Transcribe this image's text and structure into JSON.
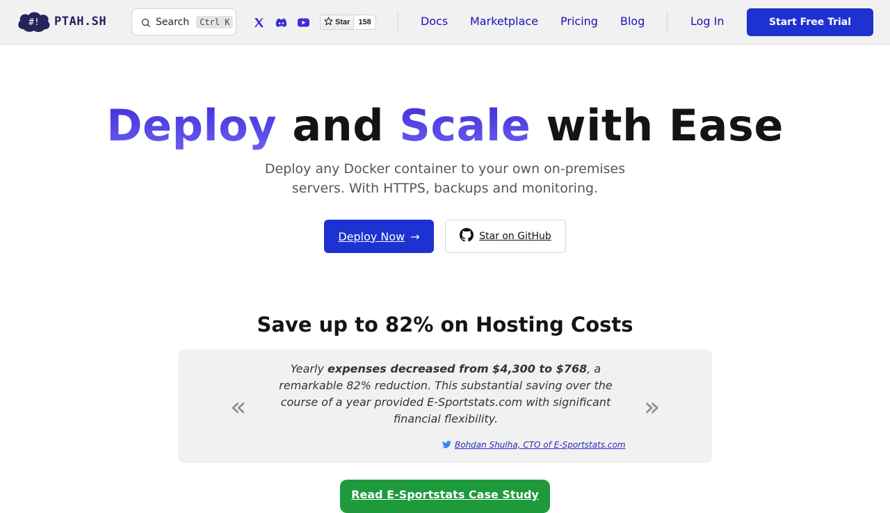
{
  "header": {
    "logo": {
      "glyph": "#!",
      "text": "PTAH.SH"
    },
    "search": {
      "label": "Search",
      "shortcut_ctrl": "Ctrl",
      "shortcut_key": "K"
    },
    "social": [
      {
        "name": "x-icon",
        "label": "X"
      },
      {
        "name": "discord-icon",
        "label": "Discord"
      },
      {
        "name": "youtube-icon",
        "label": "YouTube"
      }
    ],
    "github_star": {
      "label": "Star",
      "count": "158"
    },
    "nav": [
      {
        "label": "Docs"
      },
      {
        "label": "Marketplace"
      },
      {
        "label": "Pricing"
      },
      {
        "label": "Blog"
      }
    ],
    "login_label": "Log In",
    "trial_label": "Start Free Trial"
  },
  "hero": {
    "title_part1": "Deploy",
    "title_part2": " and ",
    "title_part3": "Scale",
    "title_part4": " with Ease",
    "subtitle": "Deploy any Docker container to your own on-premises servers. With HTTPS, backups and monitoring.",
    "deploy_label": "Deploy Now",
    "deploy_arrow": "→",
    "github_label": "Star on GitHub"
  },
  "savings": {
    "title": "Save up to 82% on Hosting Costs",
    "quote_pre": "Yearly ",
    "quote_bold": "expenses decreased from $4,300 to $768",
    "quote_post": ", a remarkable 82% reduction. This substantial saving over the course of a year provided E-Sportstats.com with significant financial flexibility.",
    "author": "Bohdan Shulha, CTO of E-Sportstats.com",
    "prev_arrow": "«",
    "next_arrow": "»",
    "case_study_label": "Read E-Sportstats Case Study"
  },
  "colors": {
    "brand_blue": "#1d32d0",
    "nav_link": "#1a11b0",
    "gradient_start": "#3d2ed6",
    "gradient_end": "#6a5ff0",
    "case_study_green": "#1e9a3c"
  }
}
